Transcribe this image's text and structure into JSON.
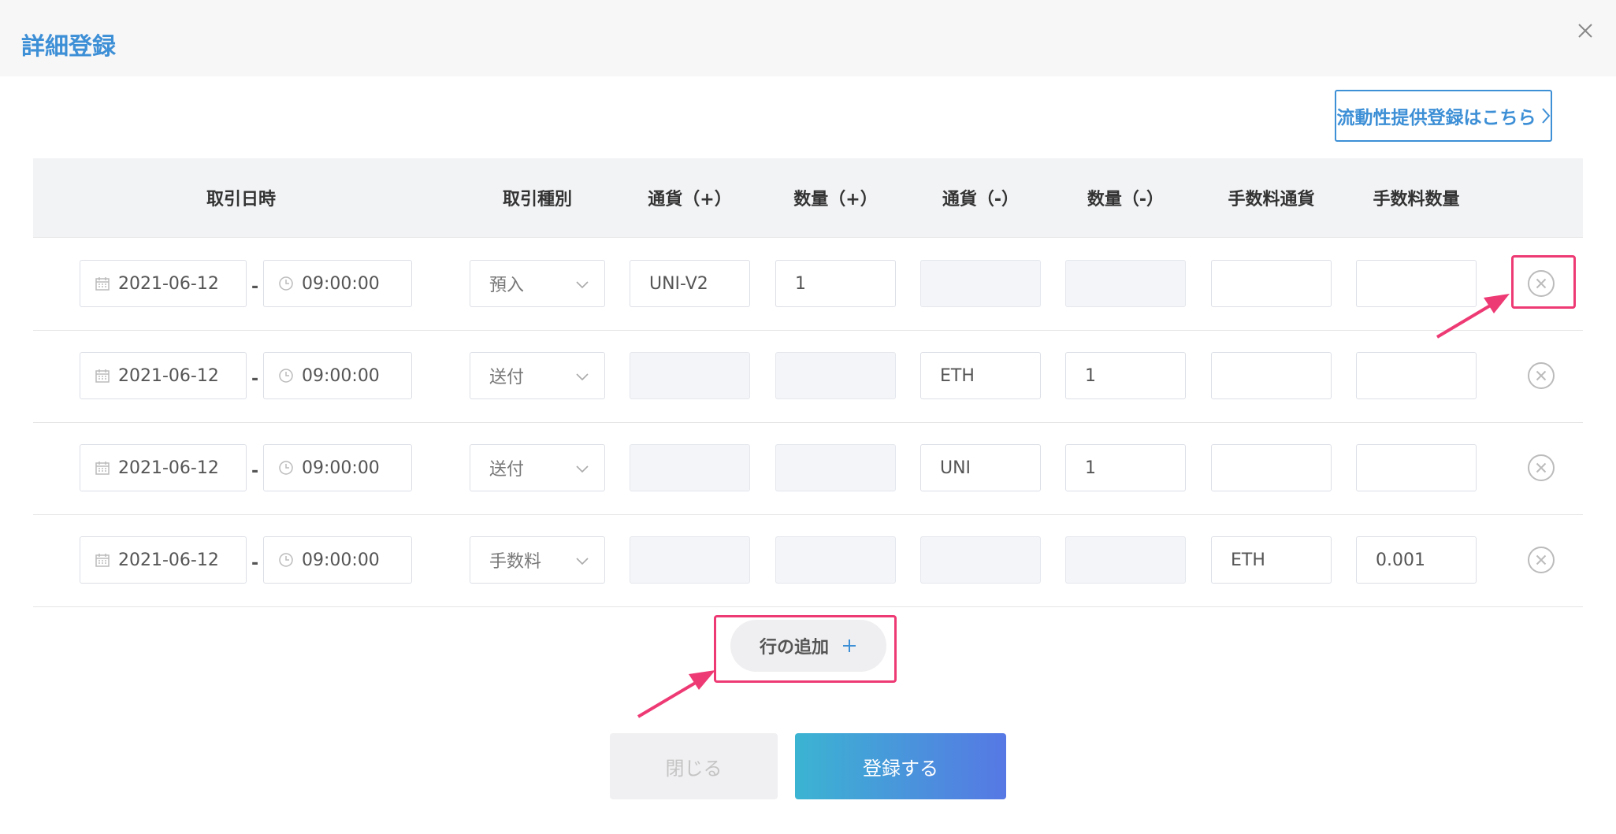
{
  "dialog": {
    "title": "詳細登録"
  },
  "liquidity_link": {
    "label": "流動性提供登録はこちら"
  },
  "table": {
    "headers": [
      "取引日時",
      "取引種別",
      "通貨（+）",
      "数量（+）",
      "通貨（-）",
      "数量（-）",
      "手数料通貨",
      "手数料数量"
    ],
    "rows": [
      {
        "date": "2021-06-12",
        "time": "09:00:00",
        "type": "預入",
        "currency_plus": "UNI-V2",
        "amount_plus": "1",
        "currency_minus": "",
        "amount_minus": "",
        "fee_currency": "",
        "fee_amount": ""
      },
      {
        "date": "2021-06-12",
        "time": "09:00:00",
        "type": "送付",
        "currency_plus": "",
        "amount_plus": "",
        "currency_minus": "ETH",
        "amount_minus": "1",
        "fee_currency": "",
        "fee_amount": ""
      },
      {
        "date": "2021-06-12",
        "time": "09:00:00",
        "type": "送付",
        "currency_plus": "",
        "amount_plus": "",
        "currency_minus": "UNI",
        "amount_minus": "1",
        "fee_currency": "",
        "fee_amount": ""
      },
      {
        "date": "2021-06-12",
        "time": "09:00:00",
        "type": "手数料",
        "currency_plus": "",
        "amount_plus": "",
        "currency_minus": "",
        "amount_minus": "",
        "fee_currency": "ETH",
        "fee_amount": "0.001"
      }
    ]
  },
  "add_row": {
    "label": "行の追加"
  },
  "footer": {
    "close_label": "閉じる",
    "submit_label": "登録する"
  },
  "colors": {
    "accent": "#3d8fd6",
    "highlight": "#ee3a74",
    "submit_gradient_start": "#3bb4d2",
    "submit_gradient_end": "#5678e4"
  }
}
